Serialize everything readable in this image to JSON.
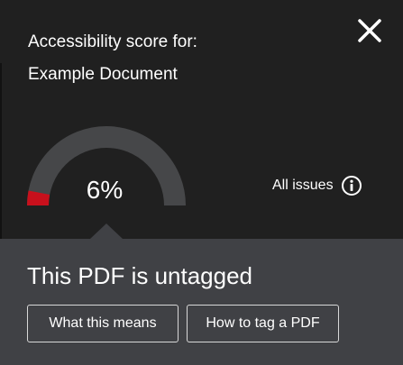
{
  "header": {
    "title_line1": "Accessibility score for:",
    "title_line2": "Example Document"
  },
  "gauge": {
    "score_text": "6%",
    "score_fraction": 0.06,
    "track_color": "#464749",
    "fill_color": "#c8101c"
  },
  "issues": {
    "label": "All issues",
    "icon": "info-icon"
  },
  "close": {
    "icon": "close-icon"
  },
  "status": {
    "message": "This PDF is untagged"
  },
  "actions": {
    "what_this_means": "What this means",
    "how_to_tag": "How to tag a PDF"
  }
}
